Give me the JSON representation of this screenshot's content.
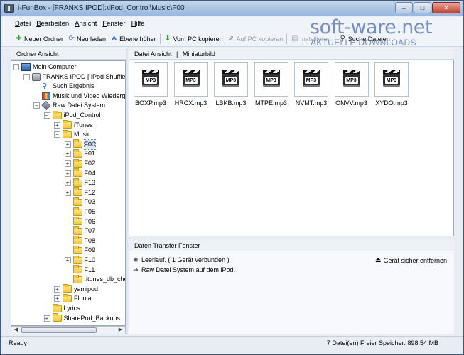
{
  "window": {
    "title": "i-FunBox - [FRANKS IPOD]:\\iPod_Control\\Music\\F00",
    "minimize": "–",
    "maximize": "□",
    "close": "✕"
  },
  "watermark": {
    "main": "soft-ware.net",
    "sub": "AKTUELLE DOWNLOADS"
  },
  "menu": [
    "Datei",
    "Bearbeiten",
    "Ansicht",
    "Fenster",
    "Hilfe"
  ],
  "toolbar": [
    {
      "label": "Neuer Ordner",
      "icon": "plus-icon",
      "glyph": "✚",
      "color": "#2f9a2f",
      "enabled": true
    },
    {
      "label": "Neu laden",
      "icon": "refresh-icon",
      "glyph": "⟳",
      "color": "#3a6fbf",
      "enabled": true
    },
    {
      "label": "Ebene höher",
      "icon": "up-level-icon",
      "glyph": "⮝",
      "color": "#3a6fbf",
      "enabled": true
    },
    {
      "label": "Vom PC kopieren",
      "icon": "copy-from-pc-icon",
      "glyph": "⬇",
      "color": "#2f9a2f",
      "enabled": true
    },
    {
      "label": "Auf PC kopieren",
      "icon": "copy-to-pc-icon",
      "glyph": "⬈",
      "color": "#9aa2ad",
      "enabled": false
    },
    {
      "label": "Installieren",
      "icon": "install-icon",
      "glyph": "▤",
      "color": "#9aa2ad",
      "enabled": false
    },
    {
      "label": "Suche Dateien",
      "icon": "search-icon",
      "glyph": "⚲",
      "color": "#333333",
      "enabled": true
    }
  ],
  "left_pane": {
    "header": "Ordner Ansicht",
    "tree": [
      {
        "label": "Mein Computer",
        "indent": 0,
        "expander": "-",
        "icon": "computer-icon"
      },
      {
        "label": "FRANKS IPOD [ iPod Shuffle ]",
        "indent": 1,
        "expander": "-",
        "icon": "ipod-icon"
      },
      {
        "label": "Such Ergebnis",
        "indent": 2,
        "expander": "",
        "icon": "search-result-icon"
      },
      {
        "label": "Musik und Video Wiedergabe",
        "indent": 2,
        "expander": "",
        "icon": "media-icon"
      },
      {
        "label": "Raw Datei System",
        "indent": 2,
        "expander": "-",
        "icon": "raw-filesystem-icon"
      },
      {
        "label": "iPod_Control",
        "indent": 3,
        "expander": "-",
        "icon": "folder-icon"
      },
      {
        "label": "iTunes",
        "indent": 4,
        "expander": "+",
        "icon": "folder-icon"
      },
      {
        "label": "Music",
        "indent": 4,
        "expander": "-",
        "icon": "folder-icon"
      },
      {
        "label": "F00",
        "indent": 5,
        "expander": "+",
        "icon": "folder-icon",
        "selected": true
      },
      {
        "label": "F01",
        "indent": 5,
        "expander": "+",
        "icon": "folder-icon"
      },
      {
        "label": "F02",
        "indent": 5,
        "expander": "+",
        "icon": "folder-icon"
      },
      {
        "label": "F04",
        "indent": 5,
        "expander": "+",
        "icon": "folder-icon"
      },
      {
        "label": "F13",
        "indent": 5,
        "expander": "+",
        "icon": "folder-icon"
      },
      {
        "label": "F12",
        "indent": 5,
        "expander": "+",
        "icon": "folder-icon"
      },
      {
        "label": "F03",
        "indent": 5,
        "expander": "",
        "icon": "folder-icon"
      },
      {
        "label": "F05",
        "indent": 5,
        "expander": "",
        "icon": "folder-icon"
      },
      {
        "label": "F06",
        "indent": 5,
        "expander": "",
        "icon": "folder-icon"
      },
      {
        "label": "F07",
        "indent": 5,
        "expander": "",
        "icon": "folder-icon"
      },
      {
        "label": "F08",
        "indent": 5,
        "expander": "",
        "icon": "folder-icon"
      },
      {
        "label": "F09",
        "indent": 5,
        "expander": "",
        "icon": "folder-icon"
      },
      {
        "label": "F10",
        "indent": 5,
        "expander": "+",
        "icon": "folder-icon"
      },
      {
        "label": "F11",
        "indent": 5,
        "expander": "",
        "icon": "folder-icon"
      },
      {
        "label": ".itunes_db_che",
        "indent": 5,
        "expander": "",
        "icon": "folder-icon"
      },
      {
        "label": "yamipod",
        "indent": 4,
        "expander": "+",
        "icon": "folder-icon"
      },
      {
        "label": "Floola",
        "indent": 4,
        "expander": "+",
        "icon": "folder-icon"
      },
      {
        "label": "Lyrics",
        "indent": 3,
        "expander": "",
        "icon": "folder-icon"
      },
      {
        "label": "SharePod_Backups",
        "indent": 3,
        "expander": "+",
        "icon": "folder-icon"
      }
    ]
  },
  "right_pane": {
    "header": "Datei Ansicht",
    "header_sep": "|",
    "view_mode": "Miniaturbild",
    "files": [
      "BOXP.mp3",
      "HRCX.mp3",
      "LBKB.mp3",
      "MTPE.mp3",
      "NVMT.mp3",
      "ONVV.mp3",
      "XYDO.mp3"
    ],
    "thumb_tag": "MP3"
  },
  "transfer": {
    "header": "Daten Transfer Fenster",
    "status": "Leerlauf. ( 1 Gerät verbunden )",
    "path": "Raw Datei System auf dem iPod.",
    "eject": "Gerät sicher entfernen"
  },
  "statusbar": {
    "left": "Ready",
    "right": "7 Datei(en)  Freier Speicher: 898.54 MB"
  }
}
